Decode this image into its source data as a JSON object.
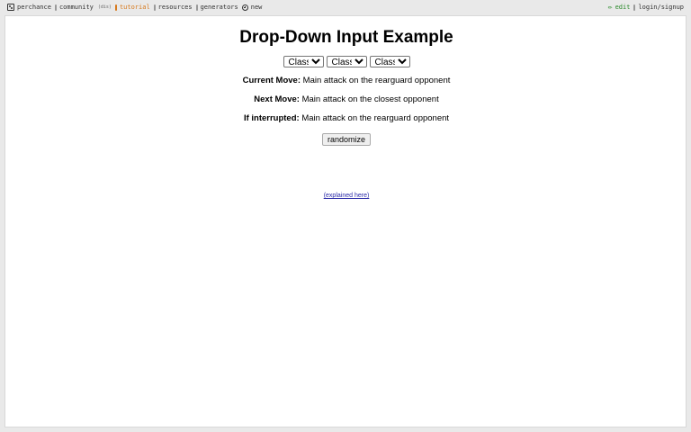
{
  "topbar": {
    "left": [
      {
        "id": "perchance",
        "label": "perchance",
        "icon": "dice-icon"
      },
      {
        "id": "community",
        "label": "community",
        "icon": "chat-icon",
        "tag": "(dis)"
      },
      {
        "id": "tutorial",
        "label": "tutorial",
        "icon": "book-icon",
        "active": true
      },
      {
        "id": "resources",
        "label": "resources",
        "icon": "folder-icon"
      },
      {
        "id": "generators",
        "label": "generators",
        "icon": "list-icon"
      },
      {
        "id": "new",
        "label": "new",
        "icon": "plus-circle-icon"
      }
    ],
    "right": [
      {
        "id": "edit",
        "label": "edit",
        "icon": "pencil-icon"
      },
      {
        "id": "login",
        "label": "login/signup",
        "icon": "user-icon"
      }
    ]
  },
  "page": {
    "title": "Drop-Down Input Example",
    "selects": [
      {
        "value": "Classic",
        "options": [
          "Classic"
        ]
      },
      {
        "value": "Classic",
        "options": [
          "Classic"
        ]
      },
      {
        "value": "Classic",
        "options": [
          "Classic"
        ]
      }
    ],
    "lines": [
      {
        "label": "Current Move:",
        "text": "Main attack on the rearguard opponent"
      },
      {
        "label": "Next Move:",
        "text": "Main attack on the closest opponent"
      },
      {
        "label": "If interrupted:",
        "text": "Main attack on the rearguard opponent"
      }
    ],
    "button_label": "randomize",
    "explained_link": "(explained here)"
  }
}
